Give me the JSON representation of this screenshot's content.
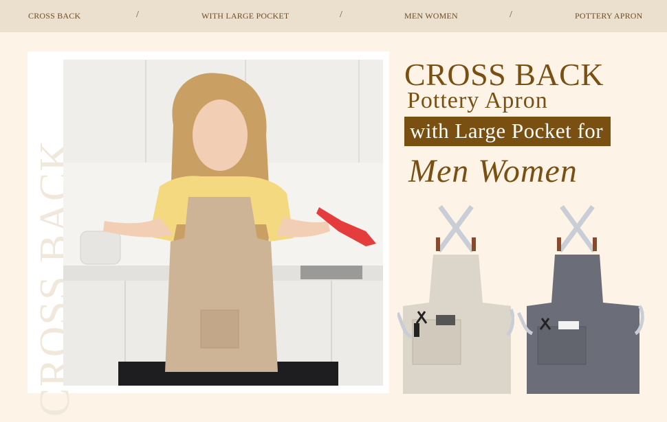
{
  "topbar": {
    "items": [
      "CROSS BACK",
      "WITH LARGE POCKET",
      "MEN WOMEN",
      "POTTERY APRON"
    ],
    "separator": "/"
  },
  "watermark": "CROSS BACK",
  "headline": {
    "line1": "CROSS BACK",
    "line2": "Pottery Apron",
    "line3": "with Large Pocket for",
    "line4": "Men Women"
  },
  "colors": {
    "brand_brown": "#7a4f12",
    "bar_bg": "#ebdfcd",
    "page_bg": "#fdf3e7",
    "apron_khaki": "#d9d2c6",
    "apron_gray": "#6b6d78"
  }
}
